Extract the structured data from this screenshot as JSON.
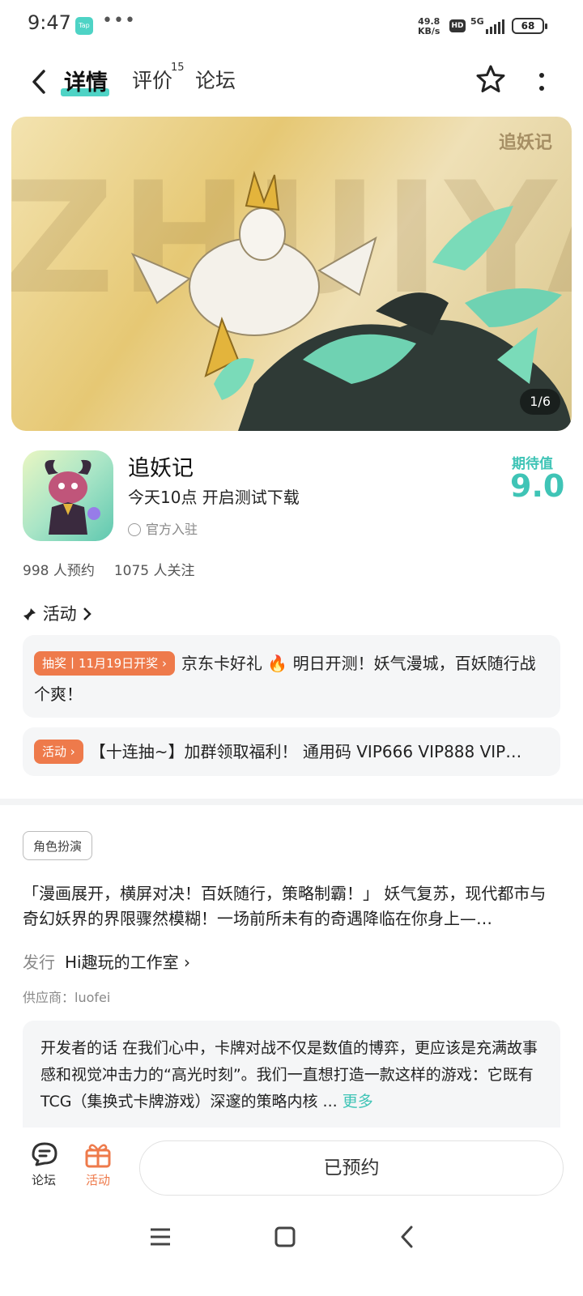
{
  "status": {
    "time": "9:47",
    "app_badge": "Tap",
    "overflow": "•••",
    "net_speed_value": "49.8",
    "net_speed_unit": "KB/s",
    "hd": "HD",
    "network": "5G",
    "battery": "68"
  },
  "nav": {
    "tabs": [
      {
        "label": "详情",
        "active": true
      },
      {
        "label": "评价",
        "count": "15"
      },
      {
        "label": "论坛"
      }
    ]
  },
  "banner": {
    "bg_text": "ZHUIYAOJI",
    "logo_text": "追妖记",
    "counter": "1/6"
  },
  "app": {
    "name": "追妖记",
    "subtitle": "今天10点 开启测试下载",
    "official": "官方入驻",
    "score_label": "期待值",
    "score": "9.0",
    "reservations": "998 人预约",
    "followers": "1075 人关注"
  },
  "activities": {
    "header": "活动",
    "items": [
      {
        "tag": "抽奖丨11月19日开奖 ›",
        "text": "京东卡好礼 🔥 明日开测！妖气漫城，百妖随行战个爽！"
      },
      {
        "tag": "活动 ›",
        "text": "【十连抽~】加群领取福利！ 通用码 VIP666 VIP888 VIP…"
      }
    ]
  },
  "details": {
    "genre": "角色扮演",
    "description": "「漫画展开，横屏对决！百妖随行，策略制霸！」 妖气复苏，现代都市与奇幻妖界的界限骤然模糊！一场前所未有的奇遇降临在你身上—…",
    "publisher_label": "发行",
    "publisher": "Hi趣玩的工作室 ›",
    "supplier": "供应商：luofei",
    "dev_note": "开发者的话  在我们心中，卡牌对战不仅是数值的博弈，更应该是充满故事感和视觉冲击力的“高光时刻”。我们一直想打造一款这样的游戏：它既有TCG（集换式卡牌游戏）深邃的策略内核 ...",
    "more": "更多"
  },
  "bottom": {
    "forum": "论坛",
    "activity": "活动",
    "reserve_button": "已预约"
  },
  "colors": {
    "accent": "#3fc4b6",
    "tag_orange": "#ee7a4b",
    "card_bg": "#f5f6f7"
  }
}
